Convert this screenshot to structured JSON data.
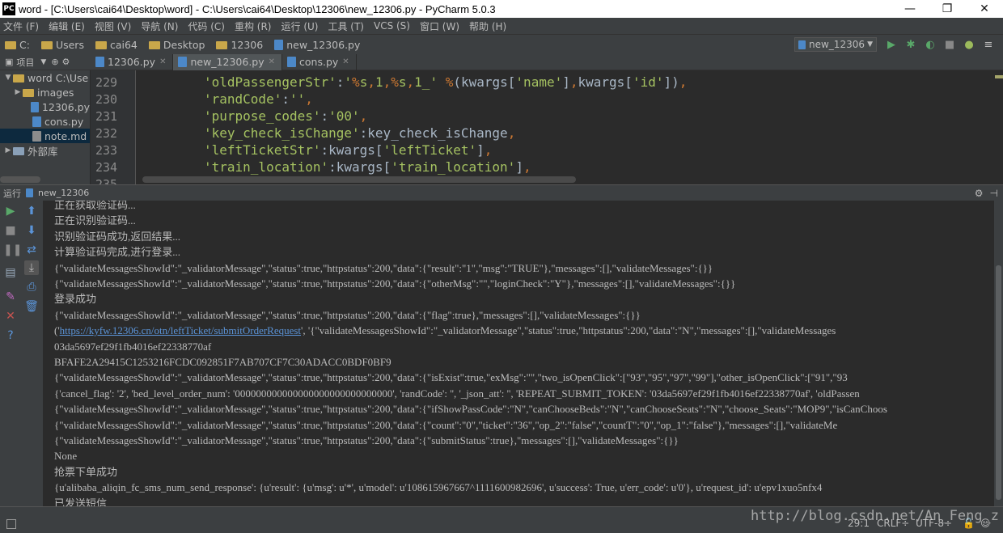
{
  "window": {
    "title": "word - [C:\\Users\\cai64\\Desktop\\word] - C:\\Users\\cai64\\Desktop\\12306\\new_12306.py - PyCharm 5.0.3",
    "logo_text": "PC",
    "minimize": "—",
    "maximize": "❐",
    "close": "✕"
  },
  "menu": [
    "文件 (F)",
    "编辑 (E)",
    "视图 (V)",
    "导航 (N)",
    "代码 (C)",
    "重构 (R)",
    "运行 (U)",
    "工具 (T)",
    "VCS (S)",
    "窗口 (W)",
    "帮助 (H)"
  ],
  "breadcrumbs": [
    "C:",
    "Users",
    "cai64",
    "Desktop",
    "12306",
    "new_12306.py"
  ],
  "run_config": "new_12306",
  "project_tab": "项目",
  "tabs": [
    {
      "label": "12306.py"
    },
    {
      "label": "new_12306.py"
    },
    {
      "label": "cons.py"
    }
  ],
  "tree": [
    {
      "label": "word  C:\\Use",
      "icon": "folder-icon",
      "arrow": "▼"
    },
    {
      "label": "images",
      "icon": "folder-icon",
      "arrow": "▶"
    },
    {
      "label": "12306.py",
      "icon": "python-file-icon",
      "arrow": ""
    },
    {
      "label": "cons.py",
      "icon": "python-file-icon",
      "arrow": ""
    },
    {
      "label": "note.md",
      "icon": "markdown-file-icon",
      "arrow": "",
      "selected": true
    },
    {
      "label": "外部库",
      "icon": "library-icon",
      "arrow": "▶"
    }
  ],
  "code_lines": [
    {
      "num": "229",
      "key": "'oldPassengerStr'",
      "rest": ":'%s,1,%s,1_' %(kwargs['name'],kwargs['id']),"
    },
    {
      "num": "230",
      "key": "'randCode'",
      "rest": ":'',"
    },
    {
      "num": "231",
      "key": "'purpose_codes'",
      "rest": ":'00',"
    },
    {
      "num": "232",
      "key": "'key_check_isChange'",
      "rest": ":key_check_isChange,"
    },
    {
      "num": "233",
      "key": "'leftTicketStr'",
      "rest": ":kwargs['leftTicket'],"
    },
    {
      "num": "234",
      "key": "'train_location'",
      "rest": ":kwargs['train_location'],"
    },
    {
      "num": "235",
      "key": "",
      "rest": ""
    }
  ],
  "run_panel": {
    "title": "运行",
    "config": "new_12306"
  },
  "console": [
    "正在获取验证码...",
    "正在识别验证码...",
    "识别验证码成功,返回结果...",
    "计算验证码完成,进行登录...",
    "{\"validateMessagesShowId\":\"_validatorMessage\",\"status\":true,\"httpstatus\":200,\"data\":{\"result\":\"1\",\"msg\":\"TRUE\"},\"messages\":[],\"validateMessages\":{}}",
    "{\"validateMessagesShowId\":\"_validatorMessage\",\"status\":true,\"httpstatus\":200,\"data\":{\"otherMsg\":\"\",\"loginCheck\":\"Y\"},\"messages\":[],\"validateMessages\":{}}",
    "登录成功",
    "{\"validateMessagesShowId\":\"_validatorMessage\",\"status\":true,\"httpstatus\":200,\"data\":{\"flag\":true},\"messages\":[],\"validateMessages\":{}}",
    "",
    "03da5697ef29f1fb4016ef22338770af",
    "BFAFE2A29415C1253216FCDC092851F7AB707CF7C30ADACC0BDF0BF9",
    "{\"validateMessagesShowId\":\"_validatorMessage\",\"status\":true,\"httpstatus\":200,\"data\":{\"isExist\":true,\"exMsg\":\"\",\"two_isOpenClick\":[\"93\",\"95\",\"97\",\"99\"],\"other_isOpenClick\":[\"91\",\"93",
    "{'cancel_flag': '2', 'bed_level_order_num': '000000000000000000000000000000', 'randCode': '', '_json_att': '', 'REPEAT_SUBMIT_TOKEN': '03da5697ef29f1fb4016ef22338770af', 'oldPassen",
    "{\"validateMessagesShowId\":\"_validatorMessage\",\"status\":true,\"httpstatus\":200,\"data\":{\"ifShowPassCode\":\"N\",\"canChooseBeds\":\"N\",\"canChooseSeats\":\"N\",\"choose_Seats\":\"MOP9\",\"isCanChoos",
    "{\"validateMessagesShowId\":\"_validatorMessage\",\"status\":true,\"httpstatus\":200,\"data\":{\"count\":\"0\",\"ticket\":\"36\",\"op_2\":\"false\",\"countT\":\"0\",\"op_1\":\"false\"},\"messages\":[],\"validateMe",
    "{\"validateMessagesShowId\":\"_validatorMessage\",\"status\":true,\"httpstatus\":200,\"data\":{\"submitStatus\":true},\"messages\":[],\"validateMessages\":{}}",
    "None",
    "抢票下单成功",
    "{u'alibaba_aliqin_fc_sms_num_send_response': {u'result': {u'msg': u'*', u'model': u'108615967667^1111600982696', u'success': True, u'err_code': u'0'}, u'request_id': u'epv1xuo5nfx4",
    "已发送短信"
  ],
  "console_link_line": {
    "prefix": "('",
    "link": "https://kyfw.12306.cn/otn/leftTicket/submitOrderRequest",
    "suffix": "', '{\"validateMessagesShowId\":\"_validatorMessage\",\"status\":true,\"httpstatus\":200,\"data\":\"N\",\"messages\":[],\"validateMessages"
  },
  "status": {
    "position": "29:1",
    "line_sep": "CRLF÷",
    "encoding": "UTF-8÷"
  },
  "watermark": "http://blog.csdn.net/An_Feng_z",
  "colors": {
    "string": "#a5c261",
    "punct": "#cc7832",
    "link": "#5b94d8",
    "run_green": "#59a869",
    "stop_red": "#c75450"
  }
}
